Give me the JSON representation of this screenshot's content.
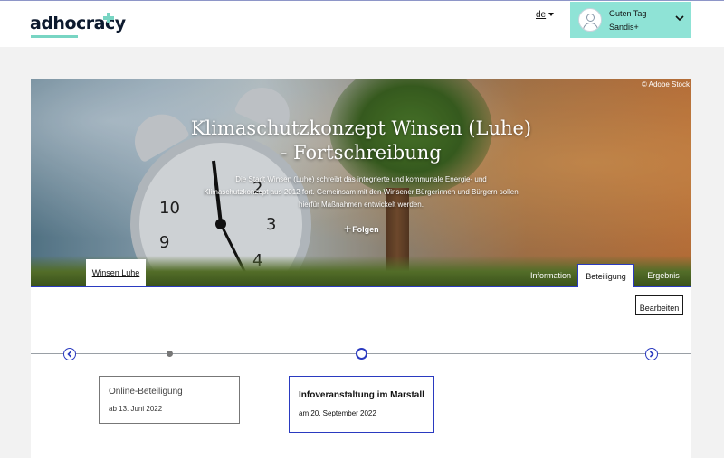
{
  "header": {
    "logo_text": "adhocracy",
    "language": "de",
    "user": {
      "greeting": "Guten Tag",
      "name": "Sandis+"
    }
  },
  "hero": {
    "credit": "© Adobe Stock",
    "title_line1": "Klimaschutzkonzept Winsen (Luhe)",
    "title_line2": "- Fortschreibung",
    "description_line1": "Die Stadt Winsen (Luhe) schreibt das integrierte und kommunale Energie- und",
    "description_line2": "Klimaschutzkonzept aus 2012 fort. Gemeinsam mit den Winsener Bürgerinnen und Bürgern sollen",
    "description_line3": "hierfür Maßnahmen entwickelt werden.",
    "follow_label": "Folgen",
    "organisation_tab": "Winsen Luhe",
    "tabs": [
      {
        "label": "Information",
        "active": false
      },
      {
        "label": "Beteiligung",
        "active": true
      },
      {
        "label": "Ergebnis",
        "active": false
      }
    ]
  },
  "main": {
    "edit_label": "Bearbeiten",
    "phases": [
      {
        "title": "Online-Beteiligung",
        "date": "ab 13. Juni 2022",
        "active": false
      },
      {
        "title": "Infoveranstaltung im Marstall",
        "date": "am 20. September 2022",
        "active": true
      }
    ]
  },
  "colors": {
    "accent": "#2a3ac0",
    "brand_mint": "#8fe3d6",
    "page_bg": "#f2f2f2"
  }
}
